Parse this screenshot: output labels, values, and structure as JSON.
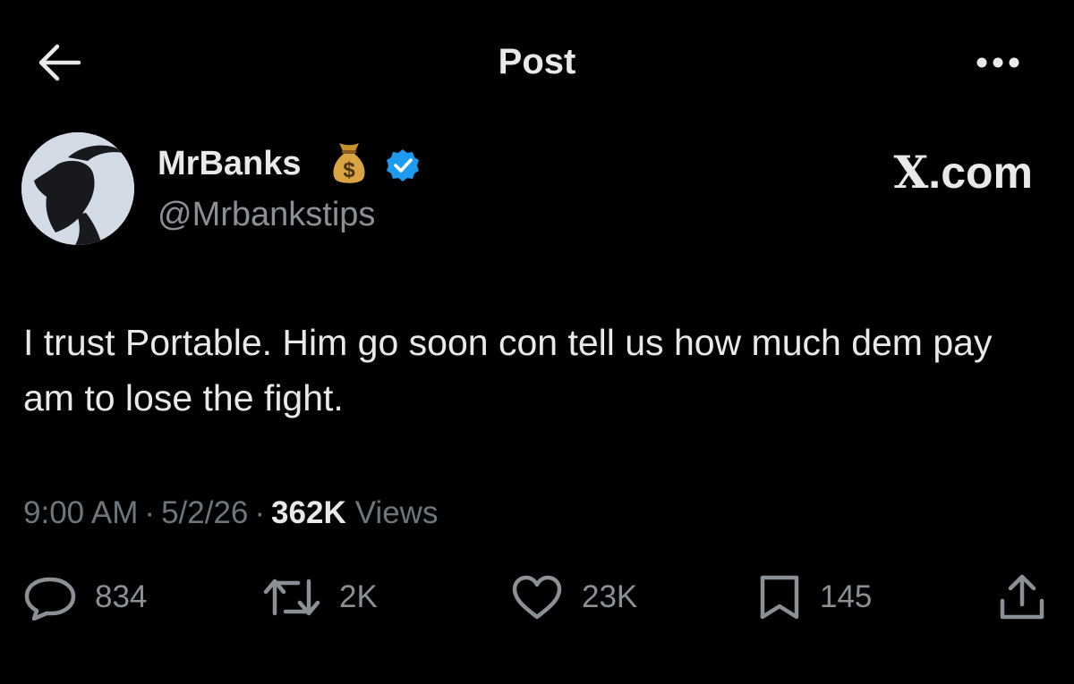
{
  "header": {
    "title": "Post",
    "back_icon": "arrow-left-icon",
    "more_icon": "ellipsis-icon"
  },
  "author": {
    "name": "MrBanks",
    "name_emoji_icon": "money-bag-icon",
    "verified_icon": "verified-badge-icon",
    "verified_color": "#1d9bf0",
    "handle": "@Mrbankstips"
  },
  "site_label": {
    "letter": "X",
    "text": ".com"
  },
  "post": {
    "text": "I trust Portable. Him go soon con tell us how much dem pay am to lose the fight."
  },
  "meta": {
    "time": "9:00 AM",
    "separator": "·",
    "date": "5/2/26",
    "views_count": "362K",
    "views_label": "Views"
  },
  "actions": {
    "replies": "834",
    "reposts": "2K",
    "likes": "23K",
    "bookmarks": "145"
  },
  "colors": {
    "background": "#000000",
    "text_primary": "#e7e9ea",
    "text_secondary": "#8b9096",
    "verified": "#1d9bf0"
  }
}
